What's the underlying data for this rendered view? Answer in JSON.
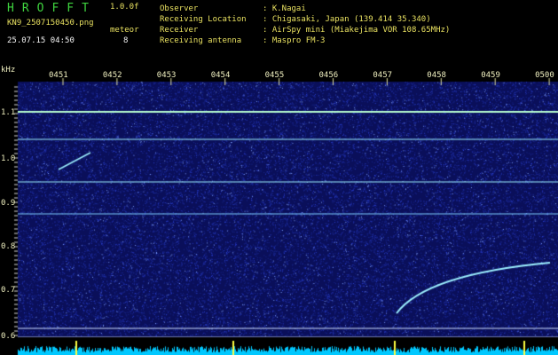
{
  "header": {
    "logo": "HROFFT",
    "version": "1.0.0f",
    "filename": "KN9_2507150450.png",
    "datetime": "25.07.15 04:50",
    "meteor_label": "meteor",
    "meteor_count": "8"
  },
  "station": {
    "rows": [
      {
        "label": "Observer",
        "value": ": K.Nagai"
      },
      {
        "label": "Receiving Location",
        "value": ": Chigasaki, Japan (139.414 35.340)"
      },
      {
        "label": "Receiver",
        "value": ": AirSpy mini (Miakejima VOR 108.65MHz)"
      },
      {
        "label": "Receiving antenna",
        "value": ": Maspro FM-3"
      }
    ]
  },
  "axes": {
    "y_unit": "kHz",
    "y_ticks": [
      "1.1",
      "1.0",
      "0.9",
      "0.8",
      "0.7",
      "0.6"
    ],
    "x_ticks": [
      "0451",
      "0452",
      "0453",
      "0454",
      "0455",
      "0456",
      "0457",
      "0458",
      "0459",
      "0500"
    ]
  },
  "colors": {
    "background": "#0a0f5a",
    "noise": "#2a3fd0",
    "signal": "#9cf0ff",
    "bright_line": "#b8ffd0",
    "bottom_band": "#00c8ff",
    "marker": "#ffff40"
  }
}
